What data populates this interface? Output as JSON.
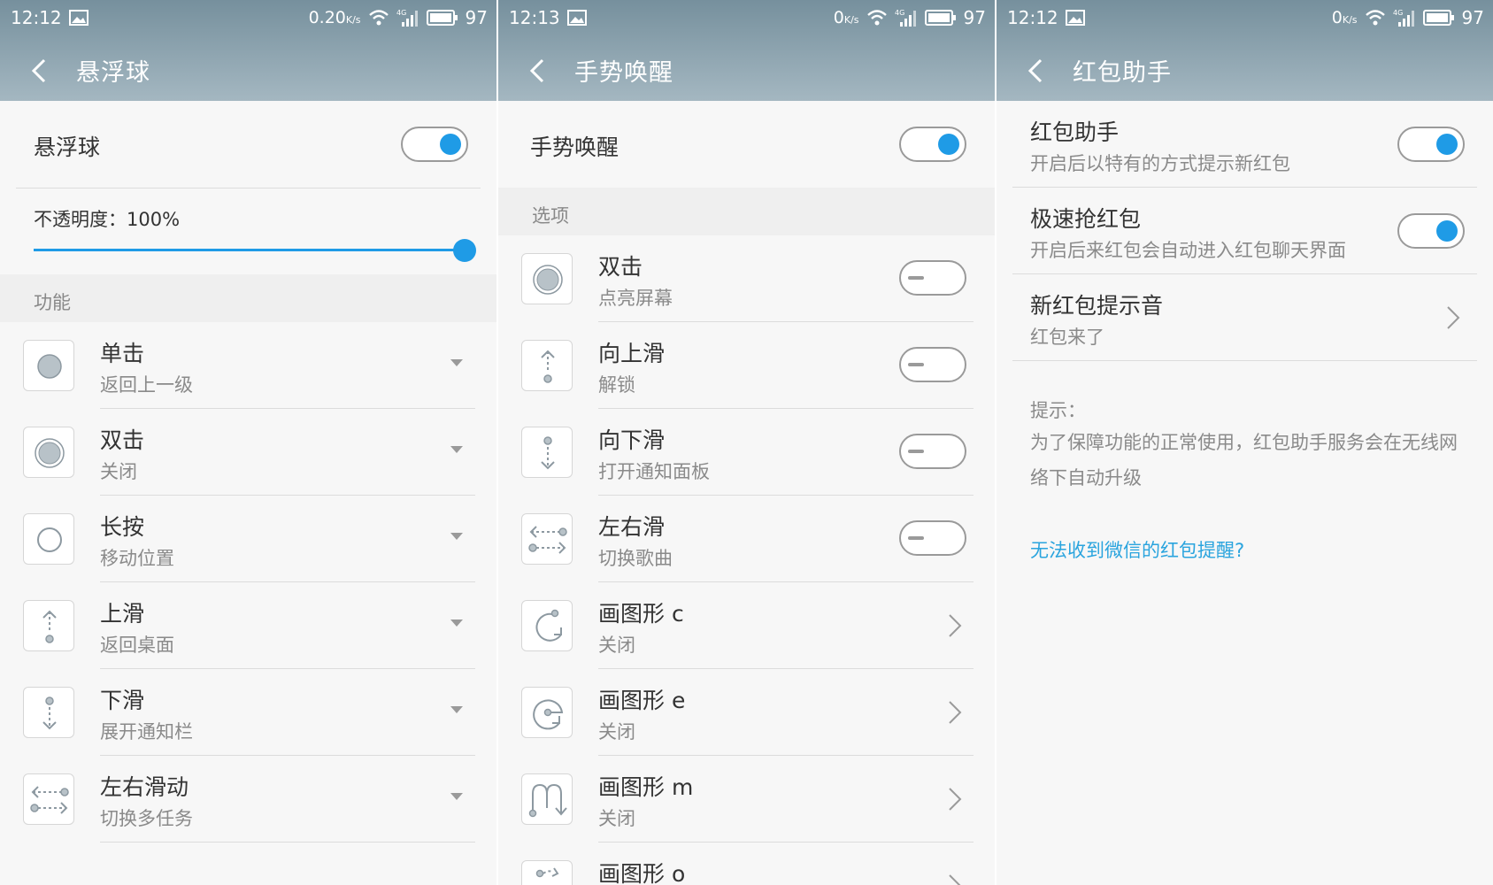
{
  "screens": [
    {
      "status": {
        "time": "12:12",
        "speed": "0.20",
        "speed_unit": "K/s",
        "battery": "97"
      },
      "title": "悬浮球",
      "main_toggle": {
        "label": "悬浮球",
        "on": true
      },
      "opacity": {
        "label": "不透明度：100%",
        "value": 100
      },
      "section": "功能",
      "items": [
        {
          "icon": "tap-icon",
          "title": "单击",
          "sub": "返回上一级"
        },
        {
          "icon": "double-tap-icon",
          "title": "双击",
          "sub": "关闭"
        },
        {
          "icon": "long-press-icon",
          "title": "长按",
          "sub": "移动位置"
        },
        {
          "icon": "swipe-up-icon",
          "title": "上滑",
          "sub": "返回桌面"
        },
        {
          "icon": "swipe-down-icon",
          "title": "下滑",
          "sub": "展开通知栏"
        },
        {
          "icon": "swipe-left-right-icon",
          "title": "左右滑动",
          "sub": "切换多任务"
        }
      ]
    },
    {
      "status": {
        "time": "12:13",
        "speed": "0",
        "speed_unit": "K/s",
        "battery": "97"
      },
      "title": "手势唤醒",
      "main_toggle": {
        "label": "手势唤醒",
        "on": true
      },
      "section": "选项",
      "items": [
        {
          "icon": "double-tap-icon",
          "title": "双击",
          "sub": "点亮屏幕",
          "control": "toggle",
          "on": false
        },
        {
          "icon": "swipe-up-icon",
          "title": "向上滑",
          "sub": "解锁",
          "control": "toggle",
          "on": false
        },
        {
          "icon": "swipe-down-icon",
          "title": "向下滑",
          "sub": "打开通知面板",
          "control": "toggle",
          "on": false
        },
        {
          "icon": "swipe-left-right-icon",
          "title": "左右滑",
          "sub": "切换歌曲",
          "control": "toggle",
          "on": false
        },
        {
          "icon": "gesture-c-icon",
          "title": "画图形 c",
          "sub": "关闭",
          "control": "chevron"
        },
        {
          "icon": "gesture-e-icon",
          "title": "画图形 e",
          "sub": "关闭",
          "control": "chevron"
        },
        {
          "icon": "gesture-m-icon",
          "title": "画图形 m",
          "sub": "关闭",
          "control": "chevron"
        },
        {
          "icon": "gesture-o-icon",
          "title": "画图形 o",
          "sub": "",
          "control": "chevron"
        }
      ]
    },
    {
      "status": {
        "time": "12:12",
        "speed": "0",
        "speed_unit": "K/s",
        "battery": "97"
      },
      "title": "红包助手",
      "items": [
        {
          "title": "红包助手",
          "sub": "开启后以特有的方式提示新红包",
          "control": "toggle",
          "on": true
        },
        {
          "title": "极速抢红包",
          "sub": "开启后来红包会自动进入红包聊天界面",
          "control": "toggle",
          "on": true
        },
        {
          "title": "新红包提示音",
          "sub": "红包来了",
          "control": "chevron"
        }
      ],
      "hint_label": "提示：",
      "hint_text": "为了保障功能的正常使用，红包助手服务会在无线网络下自动升级",
      "link": "无法收到微信的红包提醒?"
    }
  ],
  "colors": {
    "accent": "#1f9be6",
    "link": "#2aa4de",
    "appbar_top": "#76909d",
    "appbar_bottom": "#a4b7c1"
  }
}
